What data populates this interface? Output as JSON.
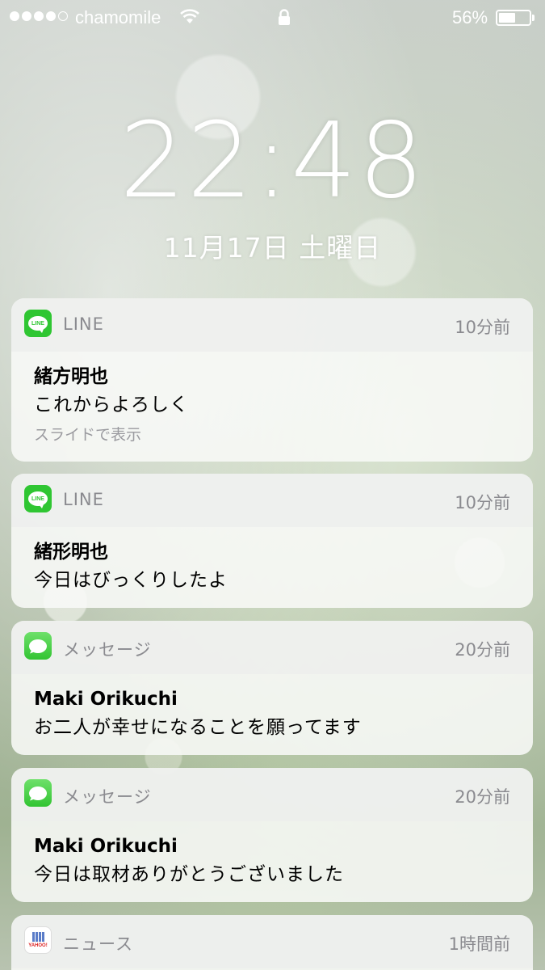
{
  "status_bar": {
    "signal_filled": 4,
    "signal_total": 5,
    "carrier": "chamomile",
    "battery_text": "56%",
    "battery_level": 0.56
  },
  "lock_screen": {
    "time": "22:48",
    "date": "11月17日 土曜日"
  },
  "notifications": [
    {
      "app": "LINE",
      "icon": "line-app-icon",
      "time": "10分前",
      "sender": "緒方明也",
      "message": "これからよろしく",
      "hint": "スライドで表示"
    },
    {
      "app": "LINE",
      "icon": "line-app-icon",
      "time": "10分前",
      "sender": "緒形明也",
      "message": "今日はびっくりしたよ"
    },
    {
      "app": "メッセージ",
      "icon": "messages-app-icon",
      "time": "20分前",
      "sender": "Maki Orikuchi",
      "message": "お二人が幸せになることを願ってます"
    },
    {
      "app": "メッセージ",
      "icon": "messages-app-icon",
      "time": "20分前",
      "sender": "Maki Orikuchi",
      "message": "今日は取材ありがとうございました"
    },
    {
      "app": "ニュース",
      "icon": "yahoo-news-icon",
      "time": "1時間前"
    }
  ],
  "colors": {
    "line_green": "#2fc632",
    "messages_green": "#32c432",
    "card_bg": "#f8f9f7",
    "meta_gray": "#8a8a8f"
  }
}
